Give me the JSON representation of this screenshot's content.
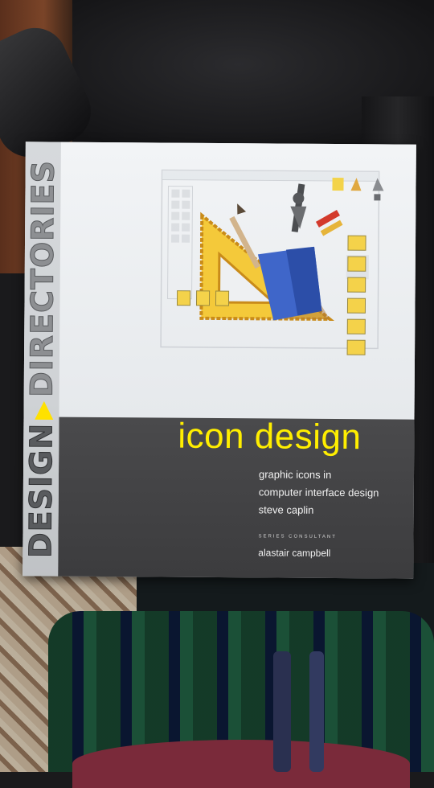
{
  "book": {
    "spine": {
      "word1": "DESIGN",
      "word2": "DIRECTORIES"
    },
    "title": "icon design",
    "subtitle_lines": [
      "graphic icons in",
      "computer interface design",
      "steve caplin"
    ],
    "consultant_label": "SERIES CONSULTANT",
    "consultant_name": "alastair campbell",
    "accent_color": "#ffee00",
    "illustration": {
      "icon_names": [
        "triangle-ruler-icon",
        "pen-nib-icon",
        "pencil-icon",
        "document-icons",
        "app-window-outline"
      ]
    }
  }
}
